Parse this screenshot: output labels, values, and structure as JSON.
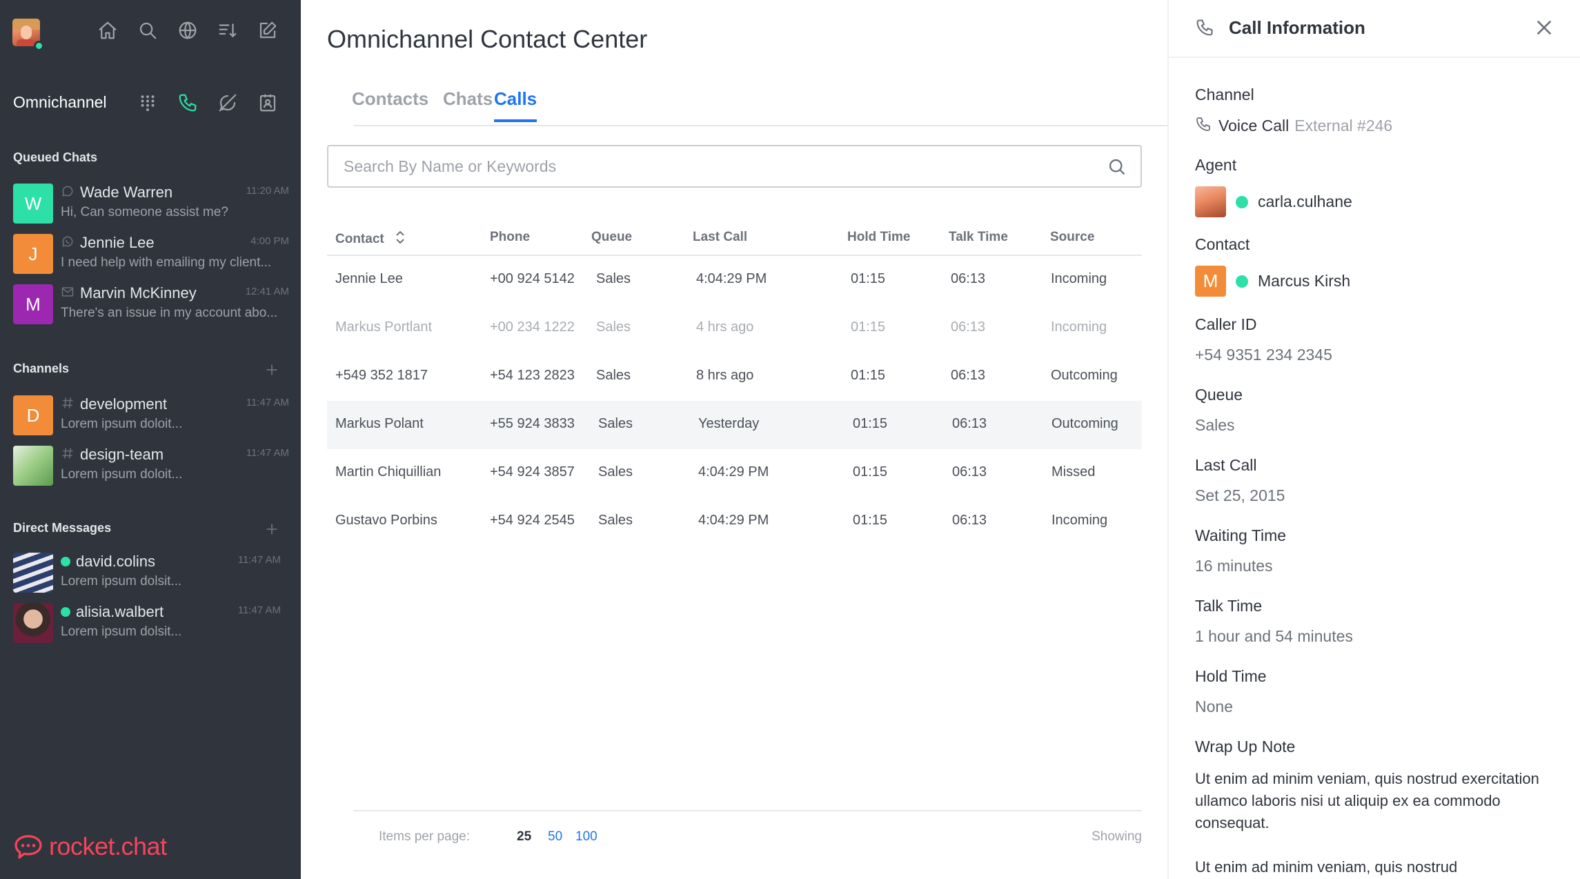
{
  "sidebar": {
    "omnichannel_title": "Omnichannel",
    "queued_title": "Queued Chats",
    "queued": [
      {
        "initial": "W",
        "color": "#2de0a5",
        "name": "Wade Warren",
        "time": "11:20 AM",
        "preview": "Hi, Can someone assist me?",
        "icon": "livechat-icon"
      },
      {
        "initial": "J",
        "color": "#f38c39",
        "name": "Jennie Lee",
        "time": "4:00 PM",
        "preview": "I need help with emailing my client...",
        "icon": "whatsapp-icon"
      },
      {
        "initial": "M",
        "color": "#9c27b0",
        "name": "Marvin McKinney",
        "time": "12:41 AM",
        "preview": "There's an issue in my account abo...",
        "icon": "mail-icon"
      }
    ],
    "channels_title": "Channels",
    "channels": [
      {
        "initial": "D",
        "color": "#f38c39",
        "name": "development",
        "time": "11:47 AM",
        "preview": "Lorem ipsum doloit...",
        "icon": "hashtag-icon"
      },
      {
        "initial": "",
        "color": "#7ab870",
        "name": "design-team",
        "time": "11:47 AM",
        "preview": "Lorem ipsum doloit...",
        "icon": "hashtag-icon"
      }
    ],
    "dm_title": "Direct Messages",
    "dms": [
      {
        "name": "david.colins",
        "time": "11:47 AM",
        "preview": "Lorem ipsum dolsit..."
      },
      {
        "name": "alisia.walbert",
        "time": "11:47 AM",
        "preview": "Lorem ipsum dolsit..."
      }
    ],
    "logo_text": "rocket.chat"
  },
  "main": {
    "title": "Omnichannel Contact Center",
    "tabs": [
      "Contacts",
      "Chats",
      "Calls"
    ],
    "active_tab": "Calls",
    "search_placeholder": "Search By Name or Keywords",
    "columns": [
      "Contact",
      "Phone",
      "Queue",
      "Last Call",
      "Hold Time",
      "Talk Time",
      "Source"
    ],
    "rows": [
      [
        "Jennie Lee",
        "+00 924 5142",
        "Sales",
        "4:04:29 PM",
        "01:15",
        "06:13",
        "Incoming"
      ],
      [
        "Markus Portlant",
        "+00 234 1222",
        "Sales",
        "4 hrs ago",
        "01:15",
        "06:13",
        "Incoming"
      ],
      [
        "+549 352 1817",
        "+54 123 2823",
        "Sales",
        "8 hrs ago",
        "01:15",
        "06:13",
        "Outcoming"
      ],
      [
        "Markus Polant",
        "+55 924 3833",
        "Sales",
        "Yesterday",
        "01:15",
        "06:13",
        "Outcoming"
      ],
      [
        "Martin Chiquillian",
        "+54 924 3857",
        "Sales",
        "4:04:29 PM",
        "01:15",
        "06:13",
        "Missed"
      ],
      [
        "Gustavo Porbins",
        "+54 924 2545",
        "Sales",
        "4:04:29 PM",
        "01:15",
        "06:13",
        "Incoming"
      ]
    ],
    "pager": {
      "label": "Items per page:",
      "options": [
        "25",
        "50",
        "100"
      ],
      "showing": "Showing"
    }
  },
  "panel": {
    "title": "Call Information",
    "channel_label": "Channel",
    "channel_value": "Voice Call",
    "channel_extra": "External #246",
    "agent_label": "Agent",
    "agent_value": "carla.culhane",
    "contact_label": "Contact",
    "contact_initial": "M",
    "contact_value": "Marcus Kirsh",
    "caller_label": "Caller ID",
    "caller_value": "+54 9351 234 2345",
    "queue_label": "Queue",
    "queue_value": "Sales",
    "lastcall_label": "Last Call",
    "lastcall_value": "Set 25, 2015",
    "waiting_label": "Waiting Time",
    "waiting_value": "16 minutes",
    "talk_label": "Talk Time",
    "talk_value": "1 hour and 54 minutes",
    "hold_label": "Hold Time",
    "hold_value": "None",
    "wrap_label": "Wrap Up Note",
    "wrap_note_1": "Ut enim ad minim veniam, quis nostrud exercitation ullamco laboris nisi ut aliquip ex ea commodo consequat.",
    "wrap_note_2": "Ut enim ad minim veniam, quis nostrud"
  },
  "colors": {
    "accent": "#1d74f5",
    "online": "#2de0a5",
    "sidebar_bg": "#2f343d",
    "brand": "#f5455c"
  }
}
